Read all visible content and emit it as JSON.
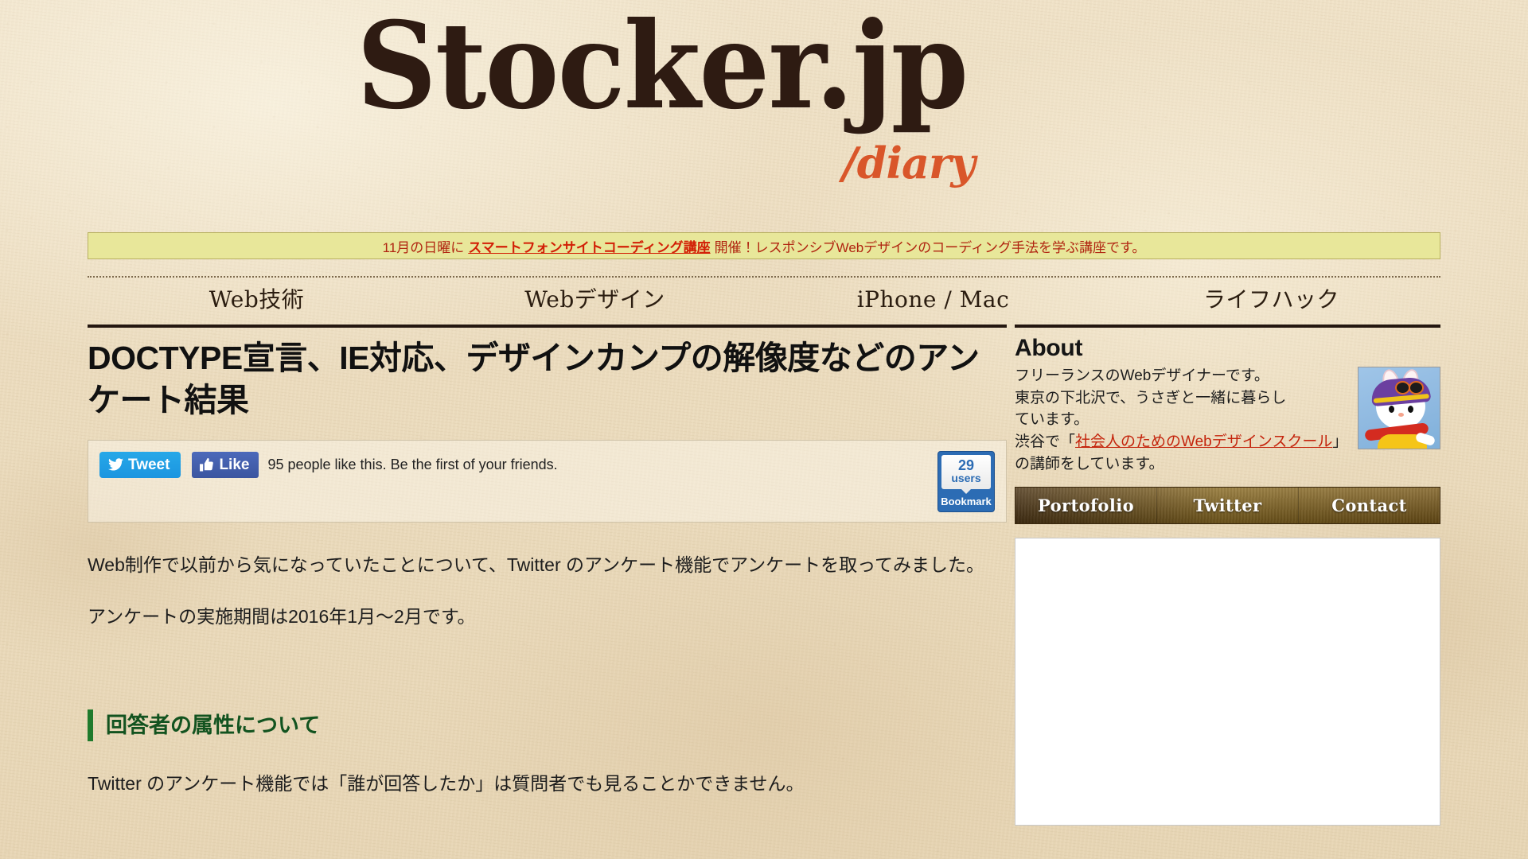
{
  "site": {
    "logo_main": "Stocker.jp",
    "logo_sub": "/diary"
  },
  "notice": {
    "prefix": "11月の日曜に",
    "link": "スマートフォンサイトコーディング講座",
    "suffix": "開催！レスポンシブWebデザインのコーディング手法を学ぶ講座です。",
    "background": "#e8e79a",
    "link_color": "#d21f05"
  },
  "nav": {
    "items": [
      {
        "label": "Web技術"
      },
      {
        "label": "Webデザイン"
      },
      {
        "label": "iPhone / Mac"
      },
      {
        "label": "ライフハック"
      }
    ]
  },
  "article": {
    "title": "DOCTYPE宣言、IE対応、デザインカンプの解像度などのアンケート結果",
    "share": {
      "tweet_label": "Tweet",
      "like_label": "Like",
      "like_caption": "95 people like this. Be the first of your friends.",
      "hatena_count": "29",
      "hatena_users_label": "users",
      "hatena_label": "Bookmark"
    },
    "paragraphs": [
      "Web制作で以前から気になっていたことについて、Twitter のアンケート機能でアンケートを取ってみました。",
      "アンケートの実施期間は2016年1月〜2月です。"
    ],
    "section_heading": "回答者の属性について",
    "section_paragraph": "Twitter のアンケート機能では「誰が回答したか」は質問者でも見ることかできません。"
  },
  "sidebar": {
    "about": {
      "title": "About",
      "line1": "フリーランスのWebデザイナーです。",
      "line2": "東京の下北沢で、うさぎと一緒に暮らし",
      "line3": "ています。",
      "line4_prefix": "渋谷で「",
      "line4_link": "社会人のためのWebデザインスクール",
      "line4_suffix": "」の講師をしています。"
    },
    "nav": {
      "items": [
        {
          "label": "Portofolio"
        },
        {
          "label": "Twitter"
        },
        {
          "label": "Contact"
        }
      ]
    }
  },
  "theme": {
    "paper": "#ecdcbe",
    "ink": "#2e1b12",
    "accent_orange": "#d9562a",
    "accent_green": "#12531f",
    "link_red": "#c4240c"
  }
}
